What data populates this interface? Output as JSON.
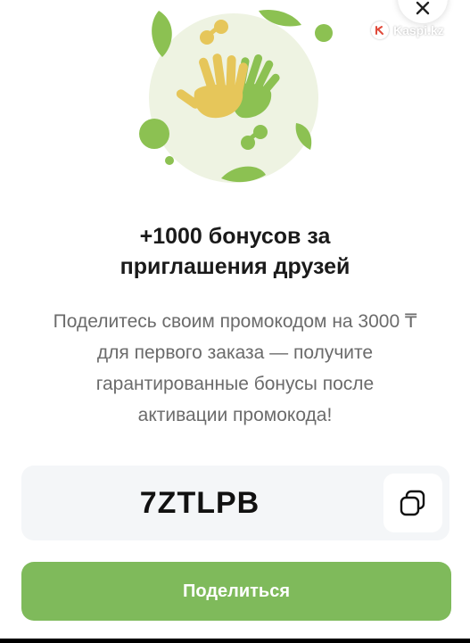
{
  "watermark": {
    "text": "Kaspi.kz"
  },
  "title": {
    "line1": "+1000 бонусов за",
    "line2": "приглашения друзей"
  },
  "description": {
    "line1": "Поделитесь своим промокодом на 3000 ₸",
    "line2": "для первого заказа — получите",
    "line3": "гарантированные бонусы после",
    "line4": "активации промокода!"
  },
  "promo": {
    "code": "7ZTLPB"
  },
  "share_button": {
    "label": "Поделиться"
  },
  "icons": {
    "close": "close-icon",
    "copy": "copy-icon",
    "logo": "kaspi-logo-icon",
    "illustration": "hands-illustration"
  },
  "colors": {
    "accent_green": "#7fba5b",
    "leaf_green": "#8cc152",
    "hand_yellow": "#e6c65a",
    "bg_circle": "#eef3e2"
  }
}
